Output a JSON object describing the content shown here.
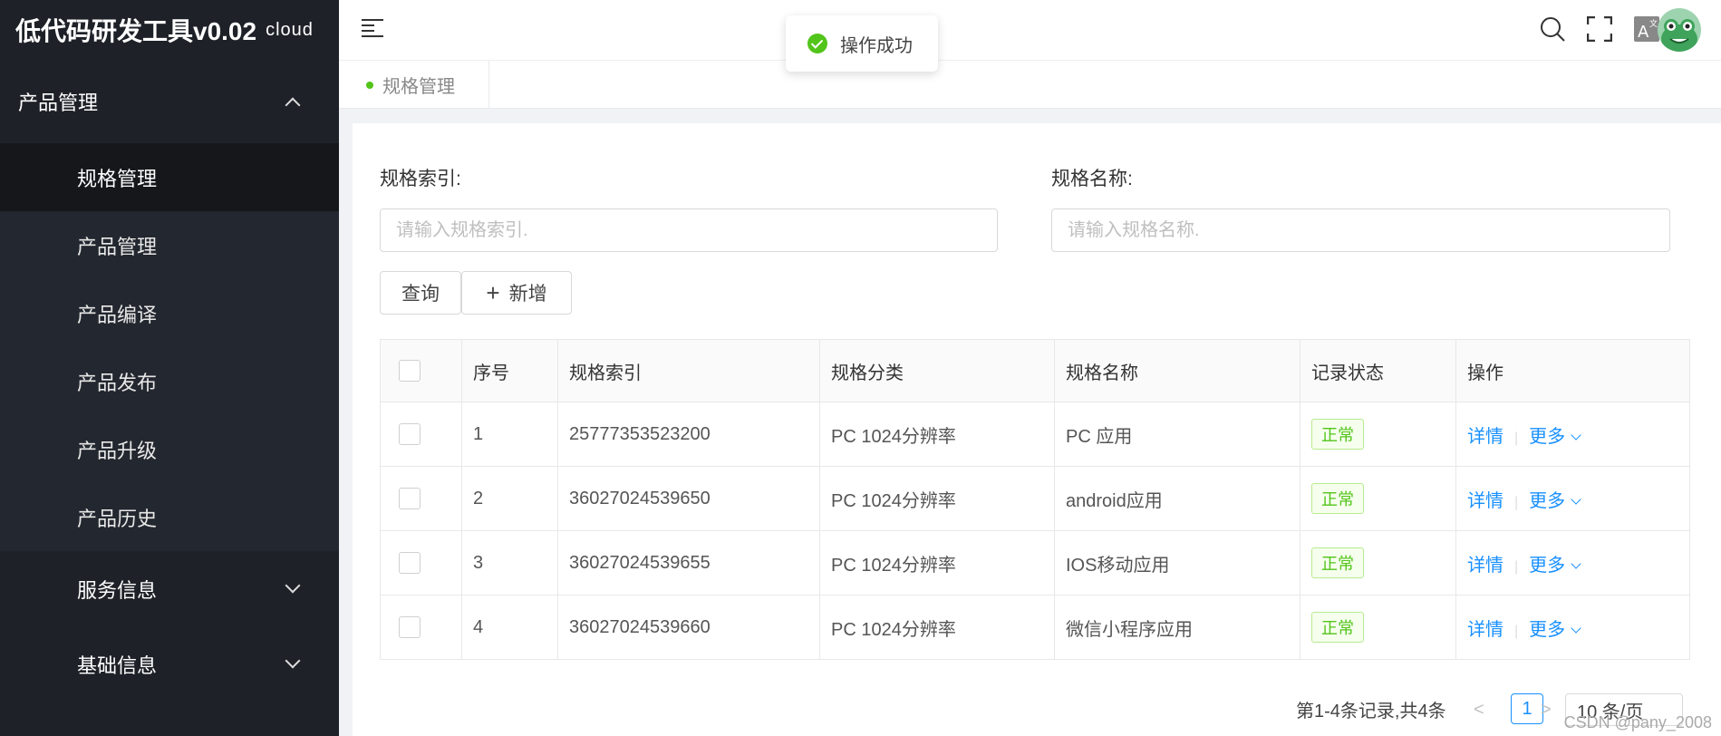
{
  "app": {
    "title": "低代码研发工具v0.02",
    "title_suffix": "cloud"
  },
  "sidebar": {
    "group_product": "产品管理",
    "items": [
      {
        "label": "规格管理"
      },
      {
        "label": "产品管理"
      },
      {
        "label": "产品编译"
      },
      {
        "label": "产品发布"
      },
      {
        "label": "产品升级"
      },
      {
        "label": "产品历史"
      }
    ],
    "group_service": "服务信息",
    "group_basic": "基础信息"
  },
  "toast": {
    "message": "操作成功"
  },
  "tabs": [
    {
      "label": "规格管理"
    }
  ],
  "search": {
    "index_label": "规格索引:",
    "index_placeholder": "请输入规格索引.",
    "name_label": "规格名称:",
    "name_placeholder": "请输入规格名称."
  },
  "buttons": {
    "query": "查询",
    "add": "新增"
  },
  "table": {
    "headers": [
      "序号",
      "规格索引",
      "规格分类",
      "规格名称",
      "记录状态",
      "操作"
    ],
    "rows": [
      {
        "no": "1",
        "index": "25777353523200",
        "category": "PC 1024分辨率",
        "name": "PC 应用",
        "status": "正常"
      },
      {
        "no": "2",
        "index": "36027024539650",
        "category": "PC 1024分辨率",
        "name": "android应用",
        "status": "正常"
      },
      {
        "no": "3",
        "index": "36027024539655",
        "category": "PC 1024分辨率",
        "name": "IOS移动应用",
        "status": "正常"
      },
      {
        "no": "4",
        "index": "36027024539660",
        "category": "PC 1024分辨率",
        "name": "微信小程序应用",
        "status": "正常"
      }
    ],
    "action_detail": "详情",
    "action_more": "更多"
  },
  "pagination": {
    "summary": "第1-4条记录,共4条",
    "current": "1",
    "page_size": "10 条/页"
  },
  "watermark": "CSDN @pany_2008",
  "colors": {
    "sidebar_bg": "#1e2228",
    "accent": "#1890ff",
    "success": "#52c41a"
  }
}
